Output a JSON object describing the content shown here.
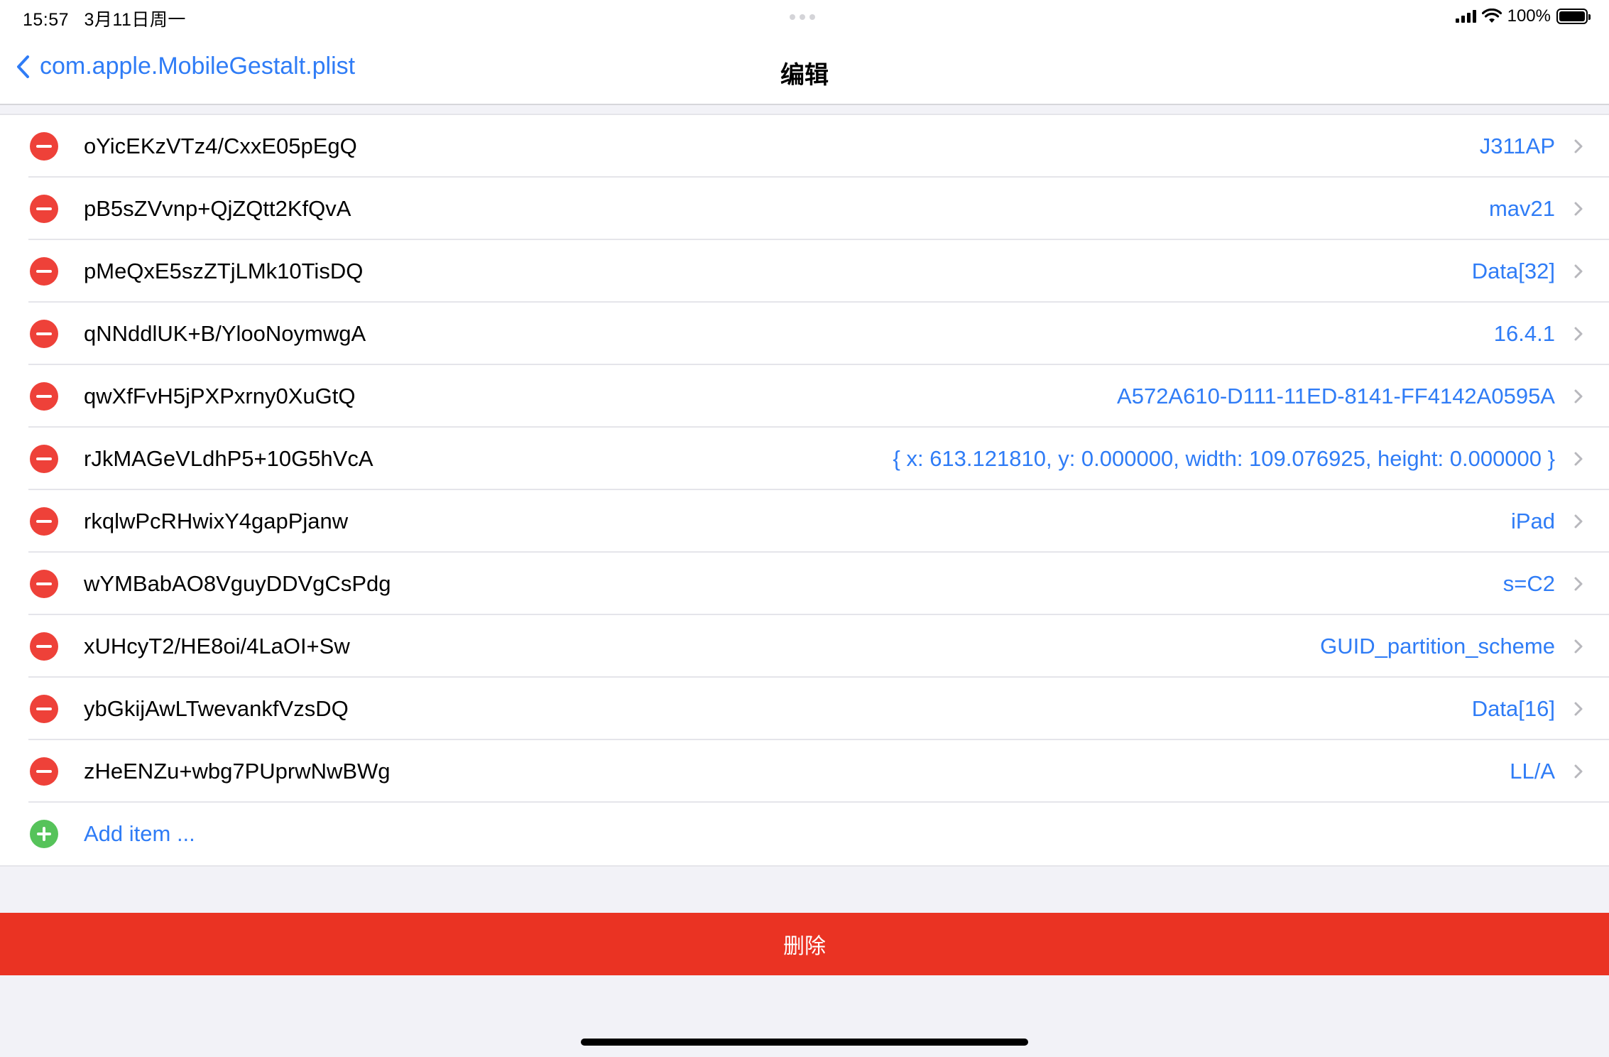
{
  "status_bar": {
    "time": "15:57",
    "date": "3月11日周一",
    "battery": "100%"
  },
  "nav": {
    "back_label": "com.apple.MobileGestalt.plist",
    "title": "编辑"
  },
  "items": [
    {
      "key": "oYicEKzVTz4/CxxE05pEgQ",
      "value": "J311AP"
    },
    {
      "key": "pB5sZVvnp+QjZQtt2KfQvA",
      "value": "mav21"
    },
    {
      "key": "pMeQxE5szZTjLMk10TisDQ",
      "value": "Data[32]"
    },
    {
      "key": "qNNddlUK+B/YlooNoymwgA",
      "value": "16.4.1"
    },
    {
      "key": "qwXfFvH5jPXPxrny0XuGtQ",
      "value": "A572A610-D111-11ED-8141-FF4142A0595A"
    },
    {
      "key": "rJkMAGeVLdhP5+10G5hVcA",
      "value": "{ x: 613.121810, y: 0.000000, width: 109.076925, height: 0.000000 }"
    },
    {
      "key": "rkqlwPcRHwixY4gapPjanw",
      "value": "iPad"
    },
    {
      "key": "wYMBabAO8VguyDDVgCsPdg",
      "value": "s=C2"
    },
    {
      "key": "xUHcyT2/HE8oi/4LaOI+Sw",
      "value": "GUID_partition_scheme"
    },
    {
      "key": "ybGkijAwLTwevankfVzsDQ",
      "value": "Data[16]"
    },
    {
      "key": "zHeENZu+wbg7PUprwNwBWg",
      "value": "LL/A"
    }
  ],
  "add_item_label": "Add item ...",
  "delete_label": "删除",
  "colors": {
    "accent": "#2f7cf6",
    "delete": "#ea3323",
    "remove_button": "#ee4139",
    "add_button": "#56c35a",
    "background": "#f2f2f7"
  },
  "icons": {
    "back": "chevron-left-icon",
    "row_disclosure": "chevron-right-icon",
    "remove": "minus-circle-icon",
    "add": "plus-circle-icon",
    "signal": "cellular-signal-icon",
    "wifi": "wifi-icon",
    "battery": "battery-icon"
  }
}
